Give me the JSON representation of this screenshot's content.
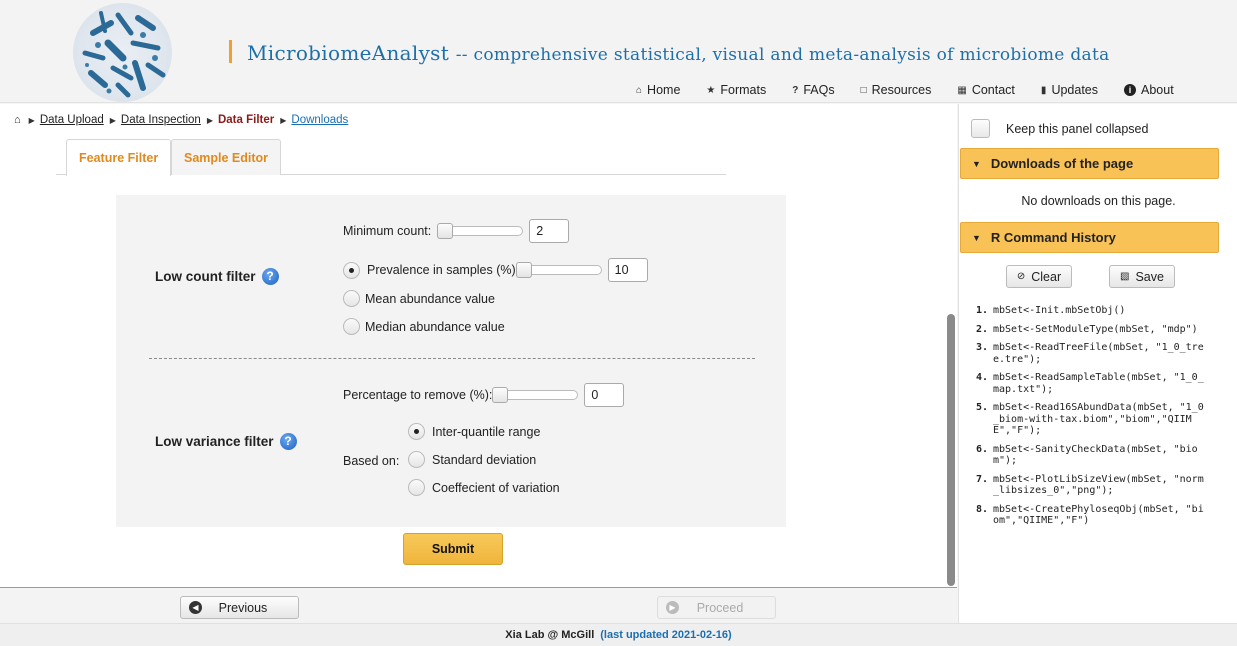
{
  "header": {
    "title_main": "MicrobiomeAnalyst",
    "title_sub": "-- comprehensive statistical, visual and meta-analysis of microbiome data",
    "nav": [
      {
        "label": "Home",
        "icon": "home-icon"
      },
      {
        "label": "Formats",
        "icon": "star-icon"
      },
      {
        "label": "FAQs",
        "icon": "question-icon"
      },
      {
        "label": "Resources",
        "icon": "document-icon"
      },
      {
        "label": "Contact",
        "icon": "contact-card-icon"
      },
      {
        "label": "Updates",
        "icon": "book-icon"
      },
      {
        "label": "About",
        "icon": "info-icon"
      }
    ]
  },
  "breadcrumb": {
    "items": [
      "Data Upload",
      "Data Inspection",
      "Data Filter",
      "Downloads"
    ]
  },
  "tabs": [
    "Feature Filter",
    "Sample Editor"
  ],
  "low_count": {
    "label": "Low count filter",
    "min_count_label": "Minimum count:",
    "min_count_value": "2",
    "options": [
      "Prevalence in samples (%)",
      "Mean abundance value",
      "Median abundance value"
    ],
    "selected": "Prevalence in samples (%)",
    "prevalence_value": "10"
  },
  "low_variance": {
    "label": "Low variance filter",
    "pct_label": "Percentage to remove (%):",
    "pct_value": "0",
    "based_on_label": "Based on:",
    "options": [
      "Inter-quantile range",
      "Standard deviation",
      "Coeffecient of variation"
    ],
    "selected": "Inter-quantile range"
  },
  "submit_label": "Submit",
  "bottom_nav": {
    "previous": "Previous",
    "proceed": "Proceed"
  },
  "right_panel": {
    "keep_collapsed": "Keep this panel collapsed",
    "downloads_title": "Downloads of the page",
    "no_downloads": "No downloads on this page.",
    "history_title": "R Command History",
    "clear_label": "Clear",
    "save_label": "Save",
    "history": [
      "mbSet<-Init.mbSetObj()",
      "mbSet<-SetModuleType(mbSet, \"mdp\")",
      "mbSet<-ReadTreeFile(mbSet, \"1_0_tree.tre\");",
      "mbSet<-ReadSampleTable(mbSet, \"1_0_map.txt\");",
      "mbSet<-Read16SAbundData(mbSet, \"1_0_biom-with-tax.biom\",\"biom\",\"QIIME\",\"F\");",
      "mbSet<-SanityCheckData(mbSet, \"biom\");",
      "mbSet<-PlotLibSizeView(mbSet, \"norm_libsizes_0\",\"png\");",
      "mbSet<-CreatePhyloseqObj(mbSet, \"biom\",\"QIIME\",\"F\")"
    ]
  },
  "footer": {
    "lab": "Xia Lab @ McGill",
    "updated": "(last updated 2021-02-16)"
  },
  "colors": {
    "accent": "#f9c257",
    "title_blue": "#1e6fa8",
    "tab_orange": "#e08a1e"
  }
}
